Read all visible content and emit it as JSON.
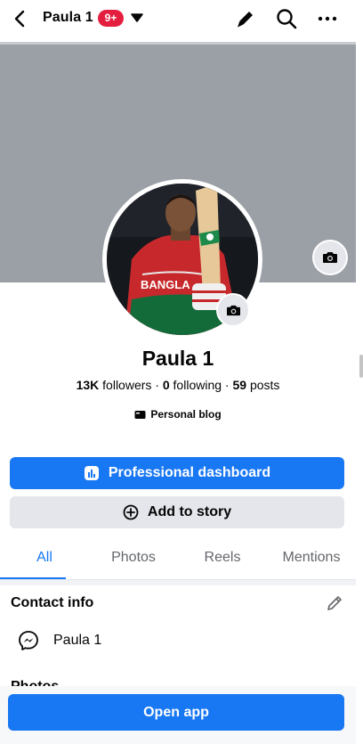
{
  "header": {
    "title": "Paula 1",
    "badge": "9+"
  },
  "profile": {
    "name": "Paula 1",
    "followers_count": "13K",
    "followers_label": "followers",
    "following_count": "0",
    "following_label": "following",
    "posts_count": "59",
    "posts_label": "posts",
    "separator": "·",
    "category": "Personal blog"
  },
  "buttons": {
    "dashboard": "Professional dashboard",
    "add_story": "Add to story",
    "open_app": "Open app"
  },
  "tabs": [
    "All",
    "Photos",
    "Reels",
    "Mentions"
  ],
  "contact": {
    "title": "Contact info",
    "messenger_name": "Paula 1"
  },
  "photos_title": "Photos",
  "colors": {
    "accent": "#1877f2",
    "badge": "#e41e3f",
    "cover": "#9aa0a6"
  },
  "icons": {
    "back": "chevron-left-icon",
    "dropdown": "caret-down-icon",
    "edit": "pencil-icon",
    "search": "search-icon",
    "more": "more-icon",
    "camera": "camera-icon",
    "dashboard": "bar-chart-icon",
    "add_story": "plus-circle-icon",
    "messenger": "messenger-icon"
  }
}
